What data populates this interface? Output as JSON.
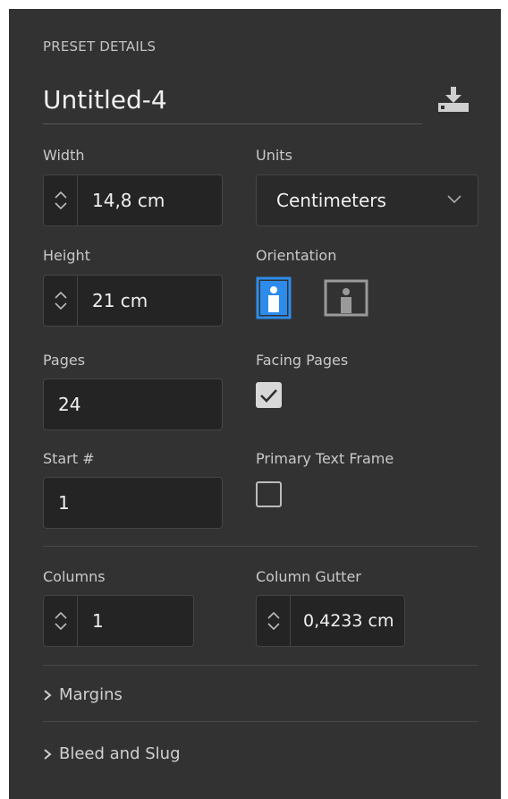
{
  "preset": {
    "heading": "PRESET DETAILS",
    "name": "Untitled-4",
    "save_icon": "save-preset-icon"
  },
  "width": {
    "label": "Width",
    "value": "14,8 cm"
  },
  "units": {
    "label": "Units",
    "value": "Centimeters"
  },
  "height": {
    "label": "Height",
    "value": "21 cm"
  },
  "orientation": {
    "label": "Orientation",
    "selected": "portrait",
    "options": [
      "portrait",
      "landscape"
    ]
  },
  "pages": {
    "label": "Pages",
    "value": "24"
  },
  "facing_pages": {
    "label": "Facing Pages",
    "checked": true
  },
  "start": {
    "label": "Start #",
    "value": "1"
  },
  "primary_text_frame": {
    "label": "Primary Text Frame",
    "checked": false
  },
  "columns": {
    "label": "Columns",
    "value": "1"
  },
  "column_gutter": {
    "label": "Column Gutter",
    "value": "0,4233 cm"
  },
  "margins": {
    "label": "Margins"
  },
  "bleed": {
    "label": "Bleed and Slug"
  },
  "colors": {
    "accent": "#2d8ceb",
    "panel": "#323232",
    "field": "#242424"
  }
}
